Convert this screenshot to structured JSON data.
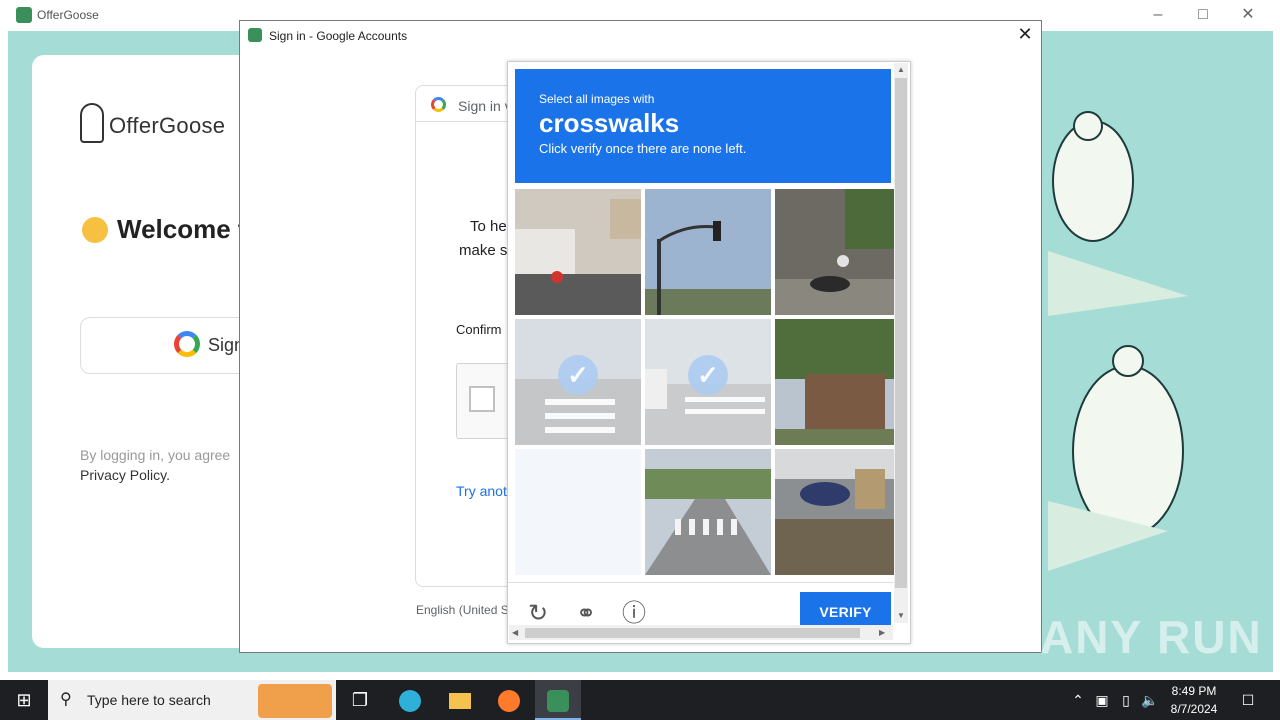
{
  "app": {
    "title": "OfferGoose",
    "logo_text": "OfferGoose",
    "welcome": "Welcome t",
    "google_button": "Sign",
    "login_note": "By logging in, you agree",
    "privacy": "Privacy Policy."
  },
  "dialog": {
    "title": "Sign in - Google Accounts",
    "header": "Sign in v",
    "help_line1": "To he",
    "help_line2": "make s",
    "confirm": "Confirm",
    "try_another": "Try anot",
    "language": "English (United S"
  },
  "captcha": {
    "instruction": "Select all images with",
    "target": "crosswalks",
    "hint": "Click verify once there are none left.",
    "verify_label": "VERIFY",
    "tiles": [
      {
        "scene": "truck",
        "selected": false
      },
      {
        "scene": "traffic-light",
        "selected": false
      },
      {
        "scene": "motorbikes",
        "selected": false
      },
      {
        "scene": "crosswalk",
        "selected": true
      },
      {
        "scene": "crosswalk-street",
        "selected": true
      },
      {
        "scene": "house",
        "selected": false
      },
      {
        "scene": "loading",
        "selected": false
      },
      {
        "scene": "crosswalk-road",
        "selected": false
      },
      {
        "scene": "motorbike-yard",
        "selected": false
      }
    ]
  },
  "watermark": "ANY RUN",
  "taskbar": {
    "search_placeholder": "Type here to search",
    "time": "8:49 PM",
    "date": "8/7/2024"
  },
  "colors": {
    "accent": "#1a73e8",
    "app_bg": "#a5ddd6",
    "taskbar": "#1d1f23"
  }
}
